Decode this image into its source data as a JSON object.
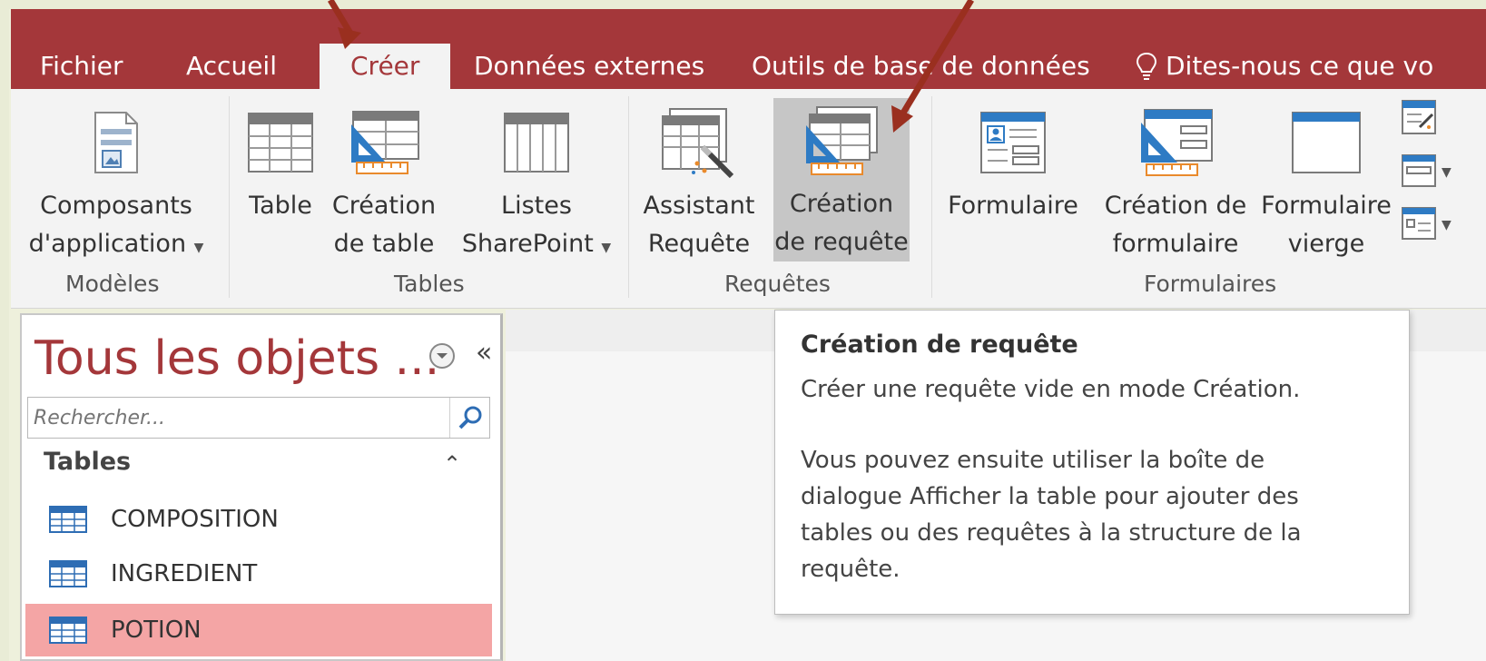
{
  "tabs": [
    {
      "label": "Fichier"
    },
    {
      "label": "Accueil"
    },
    {
      "label": "Créer"
    },
    {
      "label": "Données externes"
    },
    {
      "label": "Outils de base de données"
    },
    {
      "label": "Dites-nous ce que vo"
    }
  ],
  "ribbon": {
    "modeles": {
      "composants_line1": "Composants",
      "composants_line2": "d'application",
      "group": "Modèles"
    },
    "tables": {
      "table": "Table",
      "creation_line1": "Création",
      "creation_line2": "de table",
      "listes_line1": "Listes",
      "listes_line2": "SharePoint",
      "group": "Tables"
    },
    "requetes": {
      "assistant_line1": "Assistant",
      "assistant_line2": "Requête",
      "creation_line1": "Création",
      "creation_line2": "de requête",
      "group": "Requêtes"
    },
    "formulaires": {
      "formulaire": "Formulaire",
      "creation_line1": "Création de",
      "creation_line2": "formulaire",
      "vierge_line1": "Formulaire",
      "vierge_line2": "vierge",
      "group": "Formulaires"
    }
  },
  "nav": {
    "title": "Tous les objets ...",
    "search_placeholder": "Rechercher...",
    "section": "Tables",
    "items": [
      {
        "label": "COMPOSITION",
        "selected": false
      },
      {
        "label": "INGREDIENT",
        "selected": false
      },
      {
        "label": "POTION",
        "selected": true
      }
    ]
  },
  "tooltip": {
    "title": "Création de requête",
    "line1": "Créer une requête vide en mode Création.",
    "p2_1": "Vous pouvez ensuite utiliser la boîte de",
    "p2_2": "dialogue Afficher la table pour ajouter des",
    "p2_3": "tables ou des requêtes à la structure de la",
    "p2_4": "requête."
  },
  "colors": {
    "accent": "#a4373a",
    "selected_row": "#f4a5a5",
    "ribbon_bg": "#f3f3f3"
  },
  "icons": [
    "lightbulb-icon",
    "application-parts-icon",
    "table-icon",
    "table-design-icon",
    "sharepoint-list-icon",
    "query-wizard-icon",
    "query-design-icon",
    "form-icon",
    "form-design-icon",
    "blank-form-icon",
    "more-forms-icon",
    "navigation-icon",
    "more-forms-dropdown-icon",
    "dropdown-circle-icon",
    "collapse-chevron-icon",
    "search-icon",
    "table-row-icon",
    "annotation-arrow-icon"
  ]
}
